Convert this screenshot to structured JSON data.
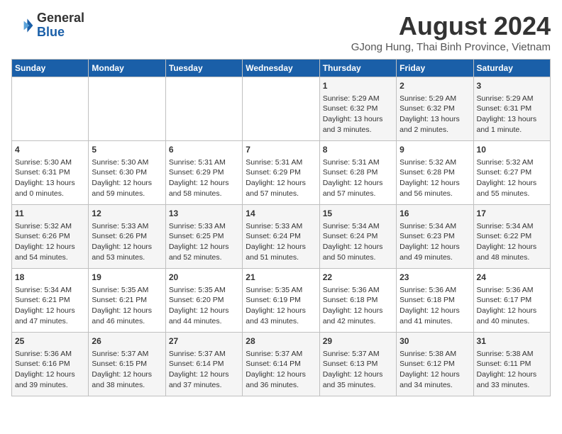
{
  "logo": {
    "general": "General",
    "blue": "Blue"
  },
  "title": "August 2024",
  "subtitle": "GJong Hung, Thai Binh Province, Vietnam",
  "days_of_week": [
    "Sunday",
    "Monday",
    "Tuesday",
    "Wednesday",
    "Thursday",
    "Friday",
    "Saturday"
  ],
  "weeks": [
    [
      {
        "day": "",
        "info": ""
      },
      {
        "day": "",
        "info": ""
      },
      {
        "day": "",
        "info": ""
      },
      {
        "day": "",
        "info": ""
      },
      {
        "day": "1",
        "info": "Sunrise: 5:29 AM\nSunset: 6:32 PM\nDaylight: 13 hours\nand 3 minutes."
      },
      {
        "day": "2",
        "info": "Sunrise: 5:29 AM\nSunset: 6:32 PM\nDaylight: 13 hours\nand 2 minutes."
      },
      {
        "day": "3",
        "info": "Sunrise: 5:29 AM\nSunset: 6:31 PM\nDaylight: 13 hours\nand 1 minute."
      }
    ],
    [
      {
        "day": "4",
        "info": "Sunrise: 5:30 AM\nSunset: 6:31 PM\nDaylight: 13 hours\nand 0 minutes."
      },
      {
        "day": "5",
        "info": "Sunrise: 5:30 AM\nSunset: 6:30 PM\nDaylight: 12 hours\nand 59 minutes."
      },
      {
        "day": "6",
        "info": "Sunrise: 5:31 AM\nSunset: 6:29 PM\nDaylight: 12 hours\nand 58 minutes."
      },
      {
        "day": "7",
        "info": "Sunrise: 5:31 AM\nSunset: 6:29 PM\nDaylight: 12 hours\nand 57 minutes."
      },
      {
        "day": "8",
        "info": "Sunrise: 5:31 AM\nSunset: 6:28 PM\nDaylight: 12 hours\nand 57 minutes."
      },
      {
        "day": "9",
        "info": "Sunrise: 5:32 AM\nSunset: 6:28 PM\nDaylight: 12 hours\nand 56 minutes."
      },
      {
        "day": "10",
        "info": "Sunrise: 5:32 AM\nSunset: 6:27 PM\nDaylight: 12 hours\nand 55 minutes."
      }
    ],
    [
      {
        "day": "11",
        "info": "Sunrise: 5:32 AM\nSunset: 6:26 PM\nDaylight: 12 hours\nand 54 minutes."
      },
      {
        "day": "12",
        "info": "Sunrise: 5:33 AM\nSunset: 6:26 PM\nDaylight: 12 hours\nand 53 minutes."
      },
      {
        "day": "13",
        "info": "Sunrise: 5:33 AM\nSunset: 6:25 PM\nDaylight: 12 hours\nand 52 minutes."
      },
      {
        "day": "14",
        "info": "Sunrise: 5:33 AM\nSunset: 6:24 PM\nDaylight: 12 hours\nand 51 minutes."
      },
      {
        "day": "15",
        "info": "Sunrise: 5:34 AM\nSunset: 6:24 PM\nDaylight: 12 hours\nand 50 minutes."
      },
      {
        "day": "16",
        "info": "Sunrise: 5:34 AM\nSunset: 6:23 PM\nDaylight: 12 hours\nand 49 minutes."
      },
      {
        "day": "17",
        "info": "Sunrise: 5:34 AM\nSunset: 6:22 PM\nDaylight: 12 hours\nand 48 minutes."
      }
    ],
    [
      {
        "day": "18",
        "info": "Sunrise: 5:34 AM\nSunset: 6:21 PM\nDaylight: 12 hours\nand 47 minutes."
      },
      {
        "day": "19",
        "info": "Sunrise: 5:35 AM\nSunset: 6:21 PM\nDaylight: 12 hours\nand 46 minutes."
      },
      {
        "day": "20",
        "info": "Sunrise: 5:35 AM\nSunset: 6:20 PM\nDaylight: 12 hours\nand 44 minutes."
      },
      {
        "day": "21",
        "info": "Sunrise: 5:35 AM\nSunset: 6:19 PM\nDaylight: 12 hours\nand 43 minutes."
      },
      {
        "day": "22",
        "info": "Sunrise: 5:36 AM\nSunset: 6:18 PM\nDaylight: 12 hours\nand 42 minutes."
      },
      {
        "day": "23",
        "info": "Sunrise: 5:36 AM\nSunset: 6:18 PM\nDaylight: 12 hours\nand 41 minutes."
      },
      {
        "day": "24",
        "info": "Sunrise: 5:36 AM\nSunset: 6:17 PM\nDaylight: 12 hours\nand 40 minutes."
      }
    ],
    [
      {
        "day": "25",
        "info": "Sunrise: 5:36 AM\nSunset: 6:16 PM\nDaylight: 12 hours\nand 39 minutes."
      },
      {
        "day": "26",
        "info": "Sunrise: 5:37 AM\nSunset: 6:15 PM\nDaylight: 12 hours\nand 38 minutes."
      },
      {
        "day": "27",
        "info": "Sunrise: 5:37 AM\nSunset: 6:14 PM\nDaylight: 12 hours\nand 37 minutes."
      },
      {
        "day": "28",
        "info": "Sunrise: 5:37 AM\nSunset: 6:14 PM\nDaylight: 12 hours\nand 36 minutes."
      },
      {
        "day": "29",
        "info": "Sunrise: 5:37 AM\nSunset: 6:13 PM\nDaylight: 12 hours\nand 35 minutes."
      },
      {
        "day": "30",
        "info": "Sunrise: 5:38 AM\nSunset: 6:12 PM\nDaylight: 12 hours\nand 34 minutes."
      },
      {
        "day": "31",
        "info": "Sunrise: 5:38 AM\nSunset: 6:11 PM\nDaylight: 12 hours\nand 33 minutes."
      }
    ]
  ]
}
